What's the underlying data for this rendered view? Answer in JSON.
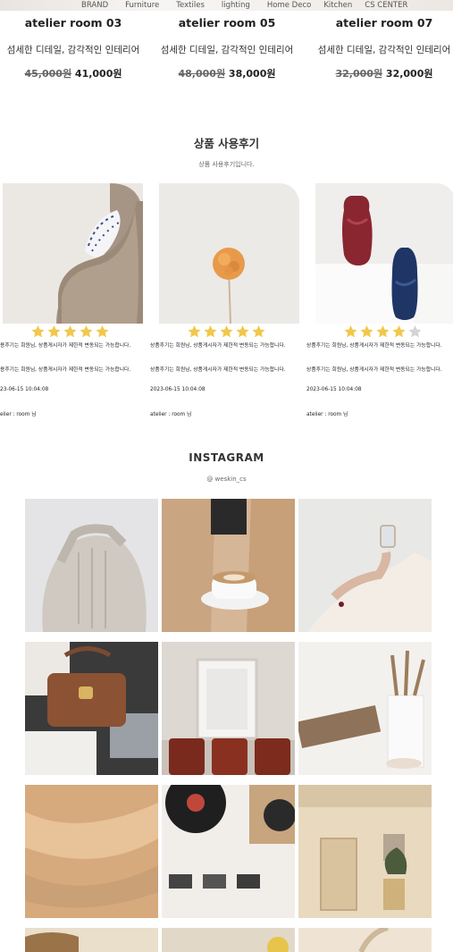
{
  "nav": {
    "items": [
      "BRAND",
      "Furniture",
      "Textiles",
      "lighting",
      "Home Deco",
      "Kitchen",
      "CS CENTER"
    ]
  },
  "products": [
    {
      "name": "atelier room 03",
      "desc": "섬세한 디테일, 감각적인 인테리어",
      "old_price": "45,000원",
      "price": "41,000원"
    },
    {
      "name": "atelier room 05",
      "desc": "섬세한 디테일, 감각적인 인테리어",
      "old_price": "48,000원",
      "price": "38,000원"
    },
    {
      "name": "atelier room 07",
      "desc": "섬세한 디테일, 감각적인 인테리어",
      "old_price": "32,000원",
      "price": "32,000원"
    }
  ],
  "reviews_section": {
    "title": "상품 사용후기",
    "subtitle": "상품 사용후기입니다."
  },
  "reviews": [
    {
      "rating": 5,
      "line1": "용후기는 회원님, 상품게시자가 제한적 변동되는 가능합니다.",
      "line2": "용후기는 회원님, 상품게시자가 제한적 변동되는 가능합니다.",
      "date": "23-06-15 10:04:08",
      "author": "elier : room 님"
    },
    {
      "rating": 5,
      "line1": "상품후기는 회원님, 상품게시자가 제한적 변동되는 가능합니다.",
      "line2": "상품후기는 회원님, 상품게시자가 제한적 변동되는 가능합니다.",
      "date": "2023-06-15 10:04:08",
      "author": "atelier : room 님"
    },
    {
      "rating": 4,
      "line1": "상품후기는 회원님, 상품게시자가 제한적 변동되는 가능합니다.",
      "line2": "상품후기는 회원님, 상품게시자가 제한적 변동되는 가능합니다.",
      "date": "2023-06-15 10:04:08",
      "author": "atelier : room 님"
    }
  ],
  "instagram": {
    "title": "INSTAGRAM",
    "handle": "@ weskin_cs"
  },
  "colors": {
    "star_on": "#f2c84b",
    "star_off": "#d4d4d4"
  }
}
